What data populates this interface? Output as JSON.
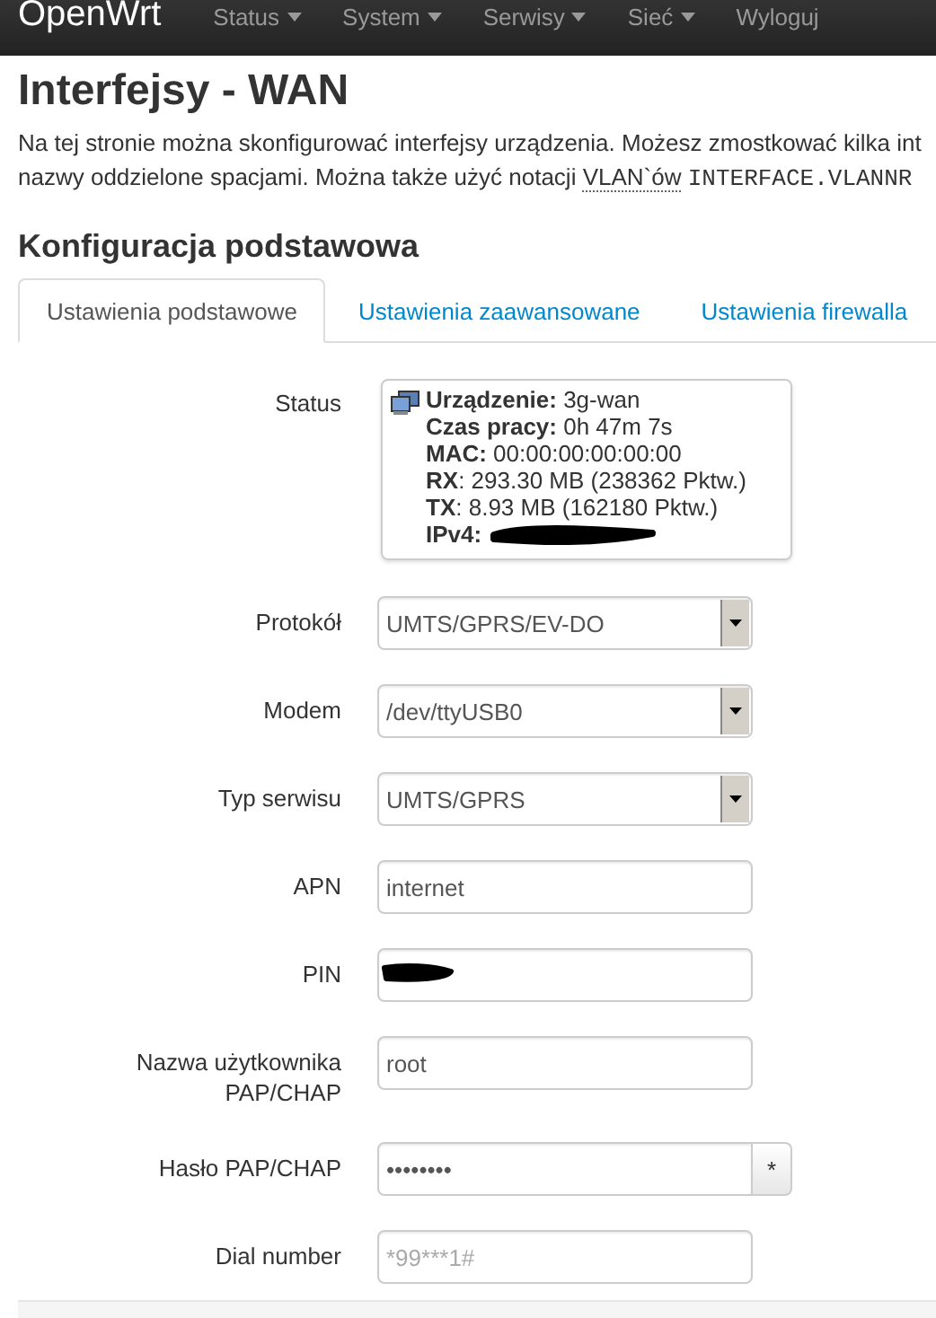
{
  "navbar": {
    "brand": "OpenWrt",
    "menus": [
      {
        "label": "Status",
        "dropdown": true
      },
      {
        "label": "System",
        "dropdown": true
      },
      {
        "label": "Serwisy",
        "dropdown": true
      },
      {
        "label": "Sieć",
        "dropdown": true
      },
      {
        "label": "Wyloguj",
        "dropdown": false
      }
    ]
  },
  "page": {
    "title": "Interfejsy - WAN",
    "intro_line_1": "Na tej stronie można skonfigurować interfejsy urządzenia. Możesz zmostkować kilka int",
    "intro_line_2": {
      "text": "nazwy oddzielone spacjami. Można także użyć notacji ",
      "link": "VLAN`ów",
      "code": "INTERFACE.VLANNR"
    }
  },
  "section": {
    "title": "Konfiguracja podstawowa",
    "tabs": [
      {
        "label": "Ustawienia podstawowe",
        "selected": true
      },
      {
        "label": "Ustawienia zaawansowane",
        "selected": false
      },
      {
        "label": "Ustawienia firewalla",
        "selected": false
      }
    ]
  },
  "status": {
    "label": "Status",
    "lines": [
      {
        "text": "**Urządzenie:** 3g-wan",
        "redacted": false
      },
      {
        "text": "**Czas pracy:** 0h 47m 7s",
        "redacted": false
      },
      {
        "text": "**MAC:** 00:00:00:00:00:00",
        "redacted": false
      },
      {
        "text": "**RX**: 293.30 MB (238362 Pktw.)",
        "redacted": false
      },
      {
        "text": "**TX**: 8.93 MB (162180 Pktw.)",
        "redacted": false
      },
      {
        "text": "**IPv4:**",
        "redacted": true
      }
    ]
  },
  "fields": [
    {
      "label": "Protokół",
      "kind": "select",
      "value": "UMTS/GPRS/EV-DO"
    },
    {
      "label": "Modem",
      "kind": "select",
      "value": "/dev/ttyUSB0"
    },
    {
      "label": "Typ serwisu",
      "kind": "select",
      "value": "UMTS/GPRS"
    },
    {
      "label": "APN",
      "kind": "text",
      "value": "internet"
    },
    {
      "label": "PIN",
      "kind": "text",
      "redacted": true
    },
    {
      "label": "Nazwa użytkownika PAP/CHAP",
      "kind": "text",
      "value": "root"
    },
    {
      "label": "Hasło PAP/CHAP",
      "kind": "password",
      "value": "••••••••",
      "reveal": "*"
    },
    {
      "label": "Dial number",
      "kind": "text",
      "placeholder": "*99***1#"
    }
  ]
}
